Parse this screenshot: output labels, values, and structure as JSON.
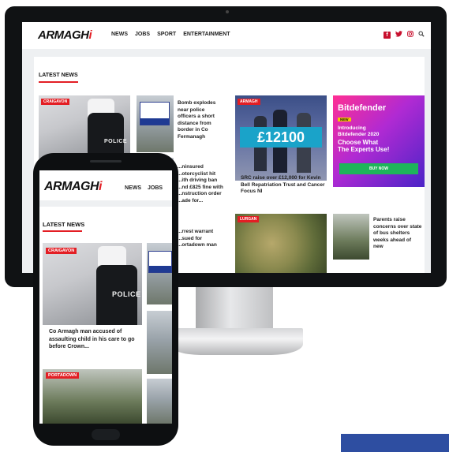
{
  "site": {
    "logo_main": "ARMAGH",
    "logo_accent": "i"
  },
  "desktop": {
    "nav": [
      "NEWS",
      "JOBS",
      "SPORT",
      "ENTERTAINMENT"
    ],
    "social_icons": [
      "facebook-icon",
      "twitter-icon",
      "instagram-icon",
      "search-icon"
    ],
    "section_title": "LATEST NEWS",
    "cards": {
      "police": {
        "tag": "CRAIGAVON",
        "image_label": "POLICE"
      },
      "bomb": {
        "headline": "Bomb explodes near police officers a short distance from border in Co Fermanagh"
      },
      "motorcyclist": {
        "headline": "...ninsured ...otorcyclist hit ...ith driving ban ...nd £825 fine with ...nstruction order ...ade for..."
      },
      "arrest": {
        "headline": "...rrest warrant ...sued for ...ortadown man"
      },
      "srcheque": {
        "tag": "ARMAGH",
        "image_label": "£12100",
        "headline": "SRC raise over £12,000 for Kevin Bell Repatriation Trust and Cancer Focus NI"
      },
      "ad": {
        "brand": "Bitdefender",
        "badge": "NEW",
        "lines": [
          "Introducing",
          "Bitdefender 2020",
          "Choose What",
          "The Experts Use!"
        ],
        "button": "BUY NOW"
      },
      "cannabis": {
        "tag": "LURGAN"
      },
      "shelters": {
        "headline": "Parents raise concerns over state of bus shelters weeks ahead of new"
      }
    }
  },
  "mobile": {
    "nav": [
      "NEWS",
      "JOBS"
    ],
    "section_title": "LATEST NEWS",
    "cards": {
      "police": {
        "tag": "CRAIGAVON",
        "image_label": "POLICE",
        "headline": "Co Armagh man accused of assaulting child in his care to go before Crown..."
      },
      "portadown": {
        "tag": "PORTADOWN"
      }
    }
  },
  "colors": {
    "brand_red": "#e31e24",
    "ad_button_green": "#1eb45a",
    "accent_blue": "#2e4ea1"
  }
}
